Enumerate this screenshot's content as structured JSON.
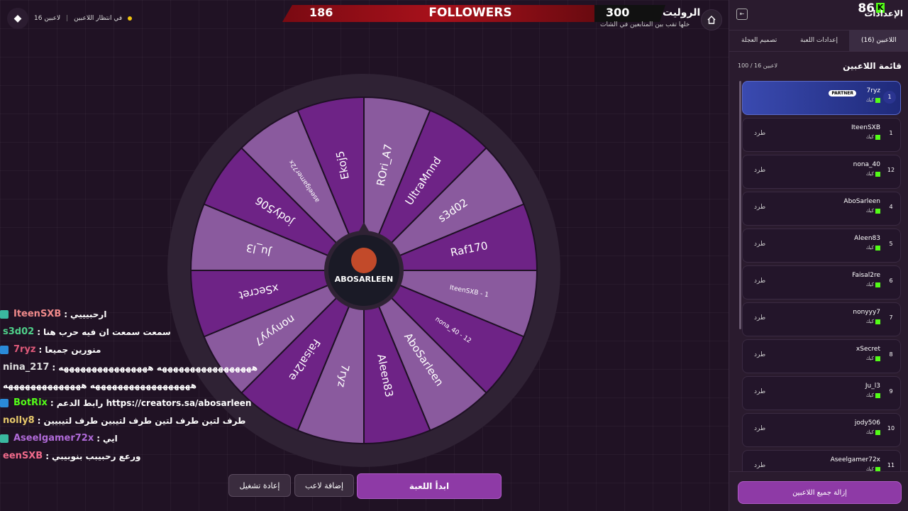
{
  "top_left": {
    "players_count": "16 لاعبين",
    "status": "في انتظار اللاعبين"
  },
  "score_bar": {
    "label": "FOLLOWERS",
    "left_value": "186",
    "right_value": "300"
  },
  "roulette": {
    "title": "الروليت",
    "subtitle": "خلها تقب بين المتابعين في الشات"
  },
  "wheel": {
    "center_label": "ABOSARLEEN",
    "segments": [
      "ROri_A7",
      "UltraMnnd",
      "s3d02",
      "Raf170",
      "IteenSXB - 1",
      "nona_40 - 12",
      "AboSarleen",
      "Aleen83",
      "7ryz",
      "Faisal2re",
      "nonyyy7",
      "xSecret",
      "Ju_l3",
      "jody506",
      "aseelgamer72x",
      "Ekoj5"
    ],
    "colors": {
      "light": "#8a5a9e",
      "dark": "#6e2386",
      "rim": "#2f2234",
      "border": "#1e1024"
    }
  },
  "chat": [
    {
      "user": "IteenSXB",
      "color": "#f08a8a",
      "msg": "ارحبيييي",
      "badge": "teal"
    },
    {
      "user": "s3d02",
      "color": "#4fd08a",
      "msg": "سمعت سمعت ان فيه حرب هنا",
      "badge": ""
    },
    {
      "user": "7ryz",
      "color": "#e05a7a",
      "msg": "منورين جميعا",
      "badge": "blue-gold"
    },
    {
      "user": "nina_217",
      "color": "#dddddd",
      "msg": "هههههههههههههههههه ههههههههههههههههه",
      "badge": ""
    },
    {
      "user": "",
      "color": "#dddddd",
      "msg": "ههههههههههههههههههه ههههههههههههههه",
      "badge": ""
    },
    {
      "user": "BotRix",
      "color": "#53fc18",
      "msg": "رابط الدعم https://creators.sa/abosarleen",
      "badge": "blue-green"
    },
    {
      "user": "nolly8",
      "color": "#e6c86a",
      "msg": "طرف لتين طرف لتين طرف لتيبين طرف لتيبيين",
      "badge": ""
    },
    {
      "user": "Aseelgamer72x",
      "color": "#b06ad8",
      "msg": "ايي",
      "badge": "teal"
    },
    {
      "user": "eenSXB",
      "color": "#f06a8a",
      "msg": "ورعع رحبيبب بنوبيبي",
      "badge": ""
    }
  ],
  "buttons": {
    "start": "ابدأ اللعبة",
    "add": "إضافة لاعب",
    "restart": "إعادة تشغيل"
  },
  "panel": {
    "title": "الإعدادات",
    "kick_count": "86",
    "tabs": [
      "اللاعبين (16)",
      "إعدادات اللعبة",
      "تصميم العجلة"
    ],
    "list_title": "قائمة اللاعبين",
    "list_count": "100 / 16 لاعبين",
    "kick_label": "طرد",
    "platform": "كيك",
    "partner": "PARTNER",
    "players": [
      {
        "num": "1",
        "name": "7ryz"
      },
      {
        "num": "1",
        "name": "IteenSXB"
      },
      {
        "num": "12",
        "name": "nona_40"
      },
      {
        "num": "4",
        "name": "AboSarleen"
      },
      {
        "num": "5",
        "name": "Aleen83"
      },
      {
        "num": "6",
        "name": "Faisal2re"
      },
      {
        "num": "7",
        "name": "nonyyy7"
      },
      {
        "num": "8",
        "name": "xSecret"
      },
      {
        "num": "9",
        "name": "Ju_l3"
      },
      {
        "num": "10",
        "name": "jody506"
      },
      {
        "num": "11",
        "name": "Aseelgamer72x"
      }
    ],
    "clear_button": "إزالة جميع اللاعبين"
  }
}
